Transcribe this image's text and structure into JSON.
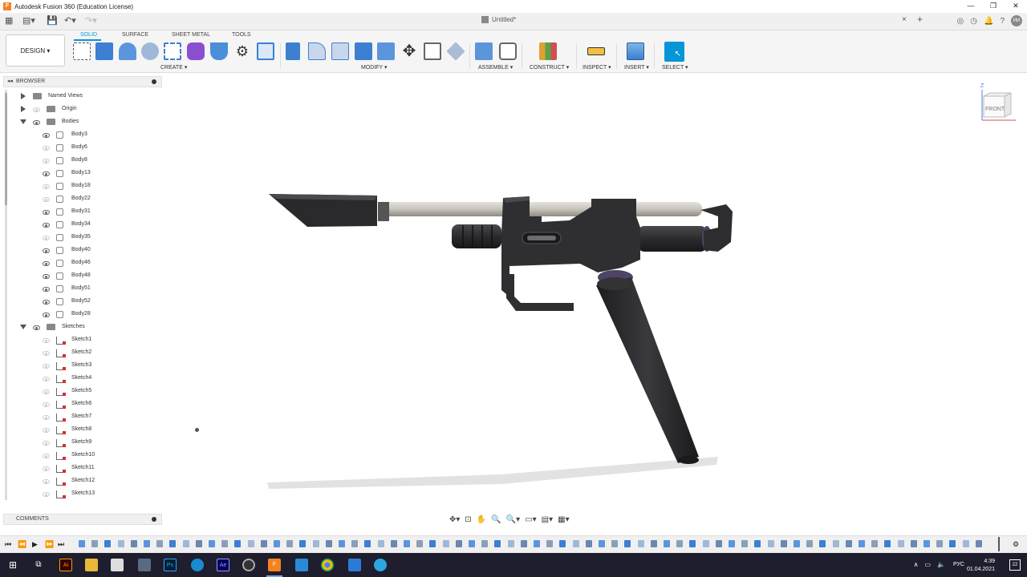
{
  "window": {
    "title": "Autodesk Fusion 360 (Education License)",
    "app_icon": "F",
    "minimize": "—",
    "restore": "❐",
    "close": "✕"
  },
  "document": {
    "tab_title": "Untitled*",
    "close": "×",
    "new_tab": "+"
  },
  "ribbon": {
    "workspace": "DESIGN",
    "tabs": [
      "SOLID",
      "SURFACE",
      "SHEET METAL",
      "TOOLS"
    ],
    "active_tab": "SOLID",
    "groups": [
      "CREATE",
      "MODIFY",
      "ASSEMBLE",
      "CONSTRUCT",
      "INSPECT",
      "INSERT",
      "SELECT"
    ]
  },
  "user": {
    "initials": "ИИ"
  },
  "browser": {
    "title": "BROWSER",
    "named_views": "Named Views",
    "origin": "Origin",
    "bodies_folder": "Bodies",
    "bodies": [
      {
        "name": "Body3",
        "visible": true
      },
      {
        "name": "Body6",
        "visible": false
      },
      {
        "name": "Body8",
        "visible": false
      },
      {
        "name": "Body13",
        "visible": true
      },
      {
        "name": "Body18",
        "visible": false
      },
      {
        "name": "Body22",
        "visible": false
      },
      {
        "name": "Body31",
        "visible": true
      },
      {
        "name": "Body34",
        "visible": true
      },
      {
        "name": "Body35",
        "visible": false
      },
      {
        "name": "Body40",
        "visible": true
      },
      {
        "name": "Body46",
        "visible": true
      },
      {
        "name": "Body48",
        "visible": true
      },
      {
        "name": "Body51",
        "visible": true
      },
      {
        "name": "Body52",
        "visible": true
      },
      {
        "name": "Body28",
        "visible": true
      }
    ],
    "sketches_folder": "Sketches",
    "sketches": [
      "Sketch1",
      "Sketch2",
      "Sketch3",
      "Sketch4",
      "Sketch5",
      "Sketch6",
      "Sketch7",
      "Sketch8",
      "Sketch9",
      "Sketch10",
      "Sketch11",
      "Sketch12",
      "Sketch13"
    ]
  },
  "comments": {
    "title": "COMMENTS"
  },
  "viewcube": {
    "face": "FRONT",
    "axis_z": "Z"
  },
  "taskbar": {
    "time": "4:39",
    "date": "01.04.2021",
    "language": "РУС",
    "notification_count": "22",
    "apps": [
      "Ai",
      "Ps",
      "Ae",
      "F"
    ]
  },
  "colors": {
    "accent": "#0696d7",
    "model_dark": "#2f2f32",
    "barrel": "#c8c6bf",
    "purple_ring": "#6a5a8a",
    "taskbar": "#1e1e2e"
  }
}
